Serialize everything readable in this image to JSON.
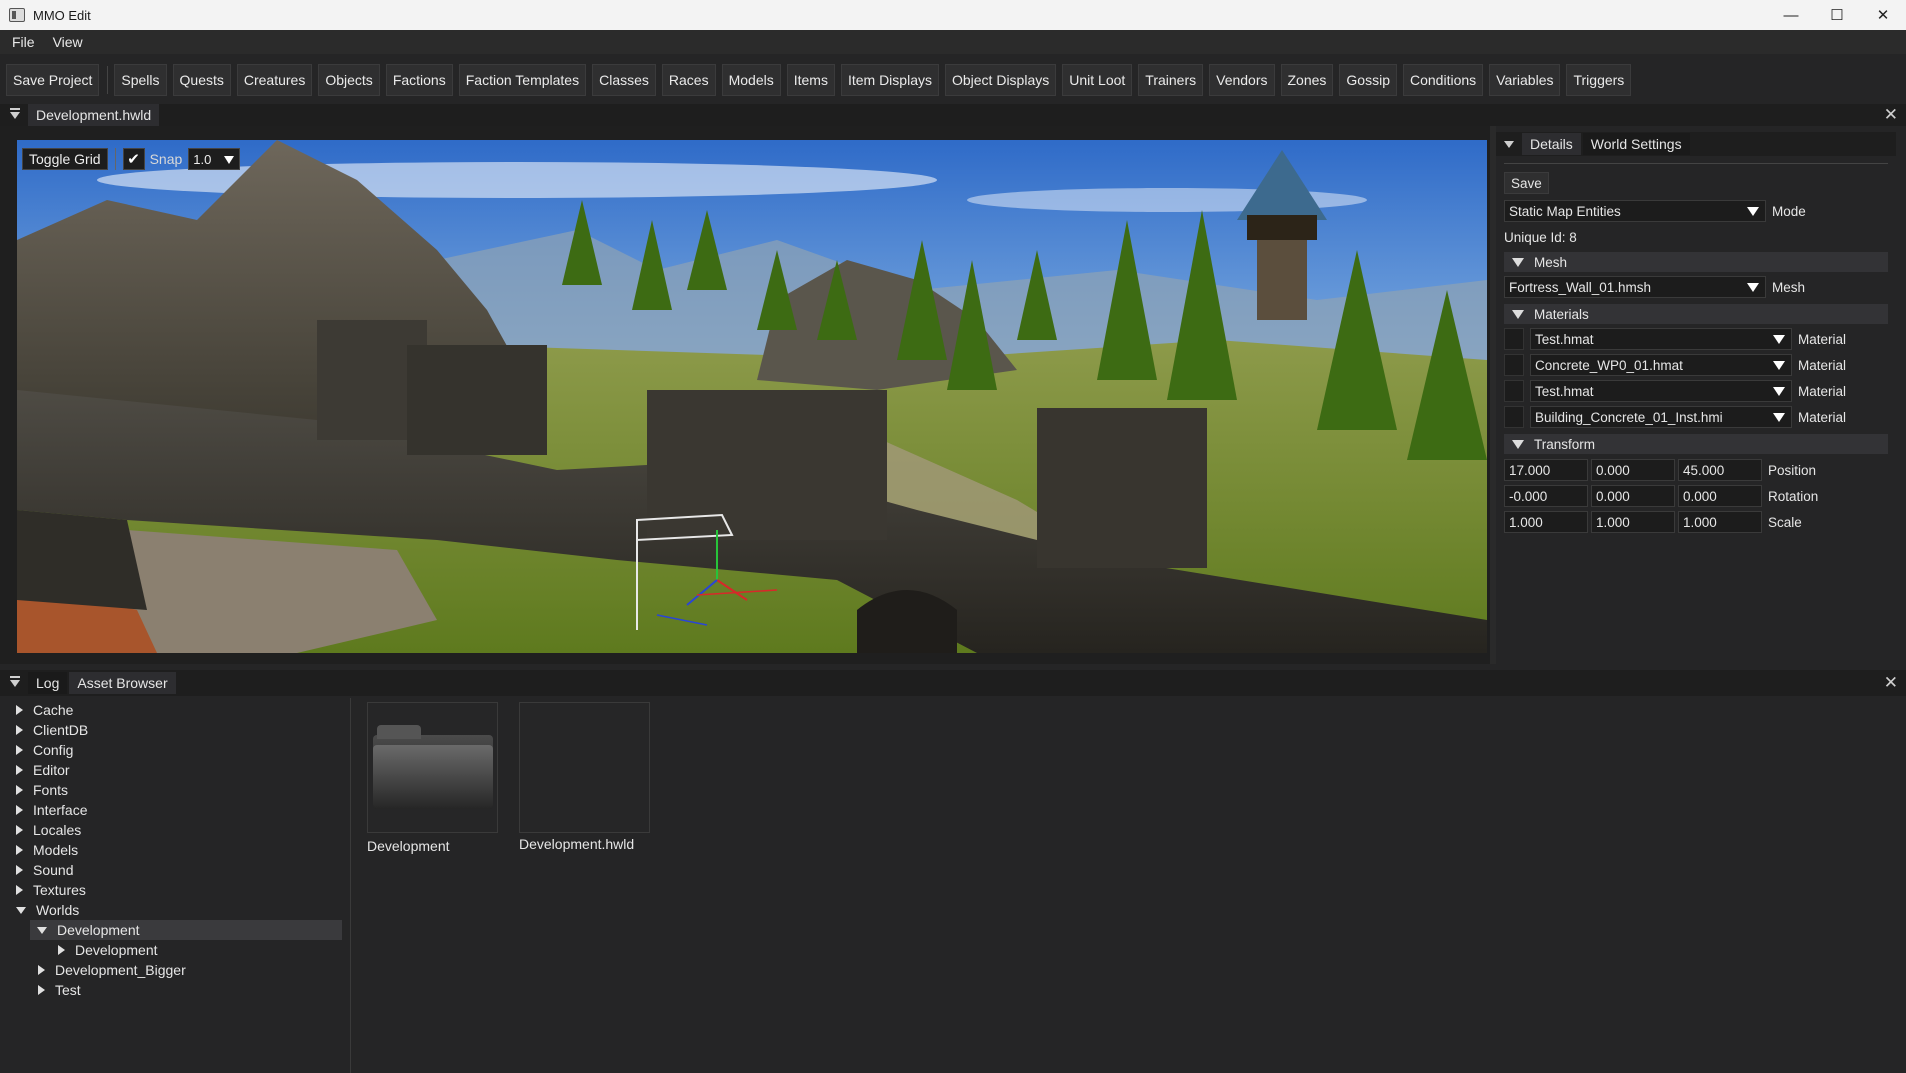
{
  "window": {
    "title": "MMO Edit",
    "minimize": "—",
    "maximize": "☐",
    "close": "✕"
  },
  "menu": [
    "File",
    "View"
  ],
  "toolbar": [
    "Save Project",
    "Spells",
    "Quests",
    "Creatures",
    "Objects",
    "Factions",
    "Faction Templates",
    "Classes",
    "Races",
    "Models",
    "Items",
    "Item Displays",
    "Object Displays",
    "Unit Loot",
    "Trainers",
    "Vendors",
    "Zones",
    "Gossip",
    "Conditions",
    "Variables",
    "Triggers"
  ],
  "document_tab": "Development.hwld",
  "viewport": {
    "toggle_grid": "Toggle Grid",
    "snap_label": "Snap",
    "snap_checked": true,
    "snap_value": "1.0"
  },
  "details": {
    "tabs": [
      "Details",
      "World Settings"
    ],
    "save": "Save",
    "mode_value": "Static Map Entities",
    "mode_label": "Mode",
    "unique_id": "Unique Id: 8",
    "mesh_section": "Mesh",
    "mesh_value": "Fortress_Wall_01.hmsh",
    "mesh_label": "Mesh",
    "materials_section": "Materials",
    "materials": [
      {
        "value": "Test.hmat",
        "label": "Material"
      },
      {
        "value": "Concrete_WP0_01.hmat",
        "label": "Material"
      },
      {
        "value": "Test.hmat",
        "label": "Material"
      },
      {
        "value": "Building_Concrete_01_Inst.hmi",
        "label": "Material"
      }
    ],
    "transform_section": "Transform",
    "transform": [
      {
        "values": [
          "17.000",
          "0.000",
          "45.000"
        ],
        "label": "Position"
      },
      {
        "values": [
          "-0.000",
          "0.000",
          "0.000"
        ],
        "label": "Rotation"
      },
      {
        "values": [
          "1.000",
          "1.000",
          "1.000"
        ],
        "label": "Scale"
      }
    ]
  },
  "bottom": {
    "tabs": [
      "Log",
      "Asset Browser"
    ],
    "tree": [
      {
        "label": "Cache",
        "expanded": false
      },
      {
        "label": "ClientDB",
        "expanded": false
      },
      {
        "label": "Config",
        "expanded": false
      },
      {
        "label": "Editor",
        "expanded": false
      },
      {
        "label": "Fonts",
        "expanded": false
      },
      {
        "label": "Interface",
        "expanded": false
      },
      {
        "label": "Locales",
        "expanded": false
      },
      {
        "label": "Models",
        "expanded": false
      },
      {
        "label": "Sound",
        "expanded": false
      },
      {
        "label": "Textures",
        "expanded": false
      },
      {
        "label": "Worlds",
        "expanded": true
      },
      {
        "label": "Development",
        "expanded": true,
        "selected": true
      },
      {
        "label": "Development",
        "expanded": false
      },
      {
        "label": "Development_Bigger",
        "expanded": false
      },
      {
        "label": "Test",
        "expanded": false
      }
    ],
    "assets": [
      {
        "label": "Development",
        "kind": "folder-icon"
      },
      {
        "label": "Development.hwld",
        "kind": "file"
      }
    ]
  }
}
